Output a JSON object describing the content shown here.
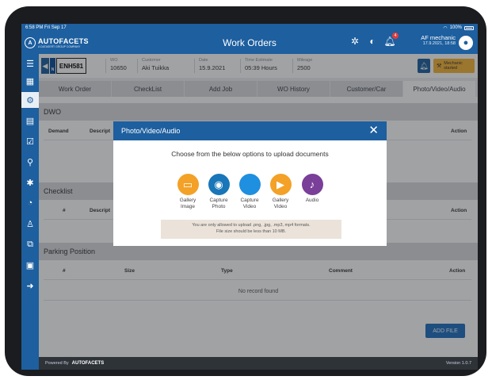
{
  "status_bar": {
    "time": "6:58 PM",
    "date": "Fri Sep 17",
    "battery": "100%"
  },
  "app": {
    "logo_text": "AUTOFACETS",
    "logo_sub": "A DATASERT GROUP COMPANY",
    "title": "Work Orders",
    "notification_count": "4"
  },
  "user": {
    "name": "AF mechanic",
    "datetime": "17.9.2021, 18:58"
  },
  "work_order": {
    "plate": "ENH581",
    "country": "N",
    "fields": [
      {
        "label": "WO",
        "value": "10650"
      },
      {
        "label": "Customer",
        "value": "Aki Tuikka"
      },
      {
        "label": "Date",
        "value": "15.9.2021"
      },
      {
        "label": "Time Estimate",
        "value": "05:39 Hours"
      },
      {
        "label": "Mileage",
        "value": "2500"
      }
    ],
    "status": "Mechanic started"
  },
  "tabs": [
    "Work Order",
    "CheckList",
    "Add Job",
    "WO History",
    "Customer/Car",
    "Photo/Video/Audio"
  ],
  "sections": {
    "dwo": {
      "title": "DWO",
      "col_demand": "Demand",
      "col_desc": "Descript",
      "col_action": "Action"
    },
    "checklist": {
      "title": "Checklist",
      "col_num": "#",
      "col_desc": "Descript",
      "col_action": "Action"
    },
    "parking": {
      "title": "Parking Position",
      "col_num": "#",
      "col_size": "Size",
      "col_type": "Type",
      "col_comment": "Comment",
      "col_action": "Action",
      "empty": "No record found"
    }
  },
  "add_file_label": "ADD FILE",
  "footer": {
    "powered_by": "Powered By",
    "logo": "AUTOFACETS",
    "version": "Version 1.0.7"
  },
  "modal": {
    "title": "Photo/Video/Audio",
    "instruction": "Choose from the below options to upload documents",
    "options": [
      {
        "line1": "Gallery",
        "line2": "Image",
        "icon": "folder-icon",
        "color": "#f3a127"
      },
      {
        "line1": "Capture",
        "line2": "Photo",
        "icon": "camera-icon",
        "color": "#1976b8"
      },
      {
        "line1": "Capture",
        "line2": "Video",
        "icon": "video-camera-icon",
        "color": "#1f8fe0"
      },
      {
        "line1": "Gallery",
        "line2": "Video",
        "icon": "video-gallery-icon",
        "color": "#f3a127"
      },
      {
        "line1": "Audio",
        "line2": "",
        "icon": "microphone-icon",
        "color": "#7a3f98"
      }
    ],
    "note_line1": "You are only allowed to upload .png, .jpg, .mp3, mp4 formats.",
    "note_line2": "File size should be less than 10 MB."
  }
}
